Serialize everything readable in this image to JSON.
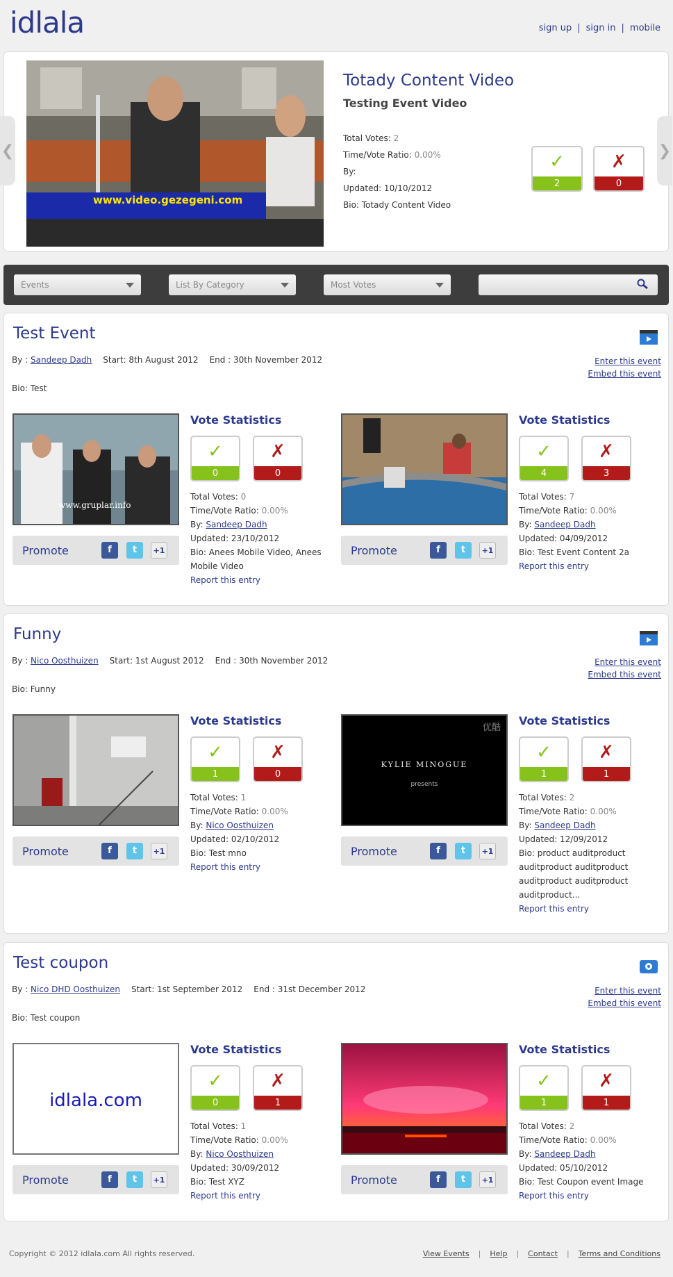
{
  "header": {
    "logo": "idlala",
    "nav": [
      "sign up",
      "sign in",
      "mobile"
    ]
  },
  "featured": {
    "title": "Totady Content Video",
    "subtitle": "Testing Event Video",
    "video_caption": "www.video.gezegeni.com",
    "total_votes_label": "Total Votes:",
    "total_votes": "2",
    "ratio_label": "Time/Vote Ratio:",
    "ratio": "0.00%",
    "by": "By:",
    "updated": "Updated: 10/10/2012",
    "bio": "Bio: Totady Content Video",
    "votes_up": "2",
    "votes_down": "0",
    "arrow_left": "❮",
    "arrow_right": "❯"
  },
  "filters": {
    "event": "Events",
    "category": "List By Category",
    "sort": "Most Votes",
    "search_placeholder": ""
  },
  "common": {
    "vote_statistics": "Vote Statistics",
    "promote": "Promote",
    "report": "Report this entry",
    "enter_event": "Enter this event",
    "embed_event": "Embed this event",
    "by_prefix": "By :",
    "total_votes": "Total Votes:",
    "ratio": "Time/Vote Ratio:",
    "by": "By:",
    "check": "✓",
    "cross": "✗",
    "fb": "f",
    "tw": "t",
    "gp": "+1"
  },
  "events": [
    {
      "title": "Test Event",
      "author": "Sandeep Dadh",
      "start": "Start: 8th August 2012",
      "end": "End : 30th November 2012",
      "bio": "Bio: Test",
      "entries": [
        {
          "up": "0",
          "down": "0",
          "total": "0",
          "ratio": "0.00%",
          "by": "Sandeep Dadh",
          "updated": "Updated: 23/10/2012",
          "bio": "Bio: Anees Mobile Video, Anees Mobile Video",
          "thumb_text": "www.gruplar.info"
        },
        {
          "up": "4",
          "down": "3",
          "total": "7",
          "ratio": "0.00%",
          "by": "Sandeep Dadh",
          "updated": "Updated: 04/09/2012",
          "bio": "Bio: Test Event Content 2a",
          "thumb_text": ""
        }
      ]
    },
    {
      "title": "Funny",
      "author": "Nico Oosthuizen",
      "start": "Start: 1st August 2012",
      "end": "End : 30th November 2012",
      "bio": "Bio: Funny",
      "entries": [
        {
          "up": "1",
          "down": "0",
          "total": "1",
          "ratio": "0.00%",
          "by": "Nico Oosthuizen",
          "updated": "Updated: 02/10/2012",
          "bio": "Bio: Test mno",
          "thumb_text": ""
        },
        {
          "up": "1",
          "down": "1",
          "total": "2",
          "ratio": "0.00%",
          "by": "Sandeep Dadh",
          "updated": "Updated: 12/09/2012",
          "bio": "Bio: product auditproduct auditproduct auditproduct auditproduct auditproduct auditproduct...",
          "thumb_text": "Kylie Minogue",
          "thumb_sub": "presents",
          "thumb_corner": "优酷"
        }
      ]
    },
    {
      "title": "Test coupon",
      "author": "Nico DHD Oosthuizen",
      "start": "Start: 1st September 2012",
      "end": "End : 31st December 2012",
      "bio": "Bio: Test coupon",
      "entries": [
        {
          "up": "0",
          "down": "1",
          "total": "1",
          "ratio": "0.00%",
          "by": "Nico Oosthuizen",
          "updated": "Updated: 30/09/2012",
          "bio": "Bio: Test XYZ",
          "thumb_text": "idlala.com"
        },
        {
          "up": "1",
          "down": "1",
          "total": "2",
          "ratio": "0.00%",
          "by": "Sandeep Dadh",
          "updated": "Updated: 05/10/2012",
          "bio": "Bio: Test Coupon event Image",
          "thumb_text": ""
        }
      ]
    }
  ],
  "footer": {
    "copyright": "Copyright © 2012 idlala.com All rights reserved.",
    "links": [
      "View Events",
      "Help",
      "Contact",
      "Terms and Conditions"
    ]
  },
  "colors": {
    "brand": "#2d3a8c",
    "vote_up": "#86c21b",
    "vote_down": "#b31b1b",
    "filter_bar": "#3d3d3d"
  }
}
